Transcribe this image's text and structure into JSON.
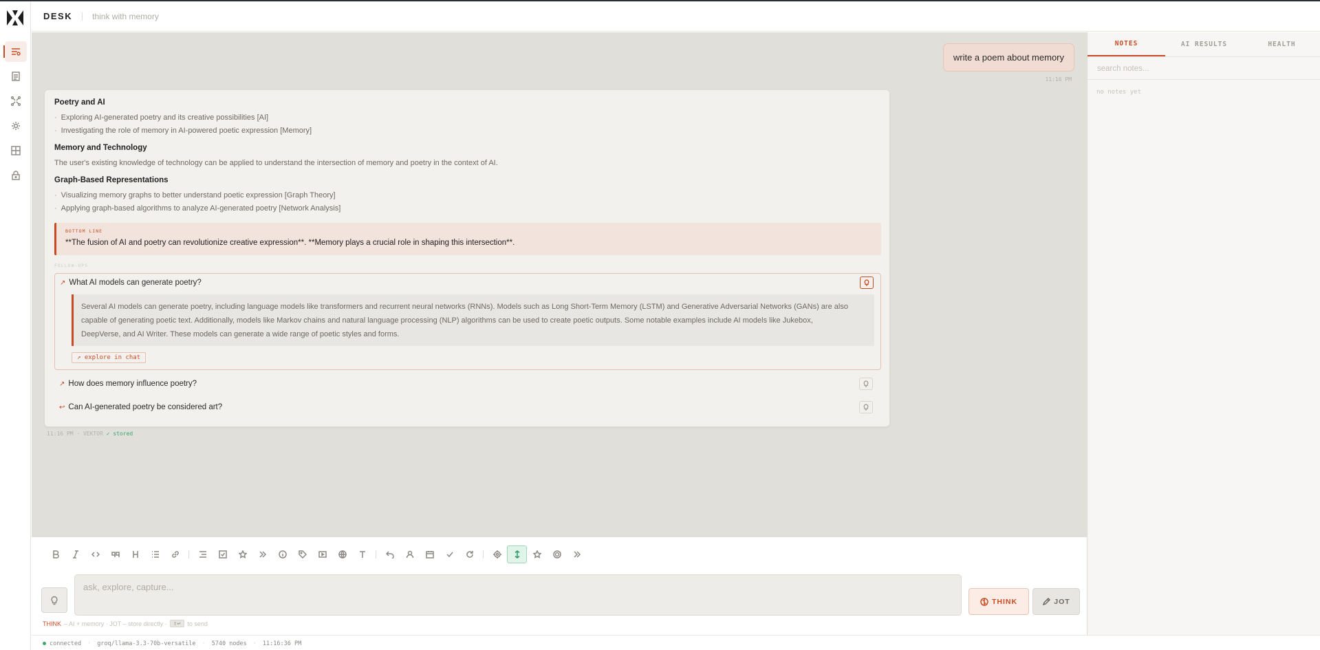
{
  "app": {
    "brand": "DESK",
    "tagline": "think with memory",
    "accent": "#c94a22"
  },
  "chat": {
    "user_message": "write a poem about memory",
    "user_timestamp": "11:16 PM",
    "response": {
      "sections": [
        {
          "heading": "Poetry and AI",
          "items": [
            "Exploring AI-generated poetry and its creative possibilities [AI]",
            "Investigating the role of memory in AI-powered poetic expression [Memory]"
          ]
        },
        {
          "heading": "Memory and Technology",
          "paragraph": "The user's existing knowledge of technology can be applied to understand the intersection of memory and poetry in the context of AI."
        },
        {
          "heading": "Graph-Based Representations",
          "items": [
            "Visualizing memory graphs to better understand poetic expression [Graph Theory]",
            "Applying graph-based algorithms to analyze AI-generated poetry [Network Analysis]"
          ]
        }
      ],
      "bottom_line_label": "BOTTOM LINE",
      "bottom_line": "**The fusion of AI and poetry can revolutionize creative expression**. **Memory plays a crucial role in shaping this intersection**.",
      "followups_label": "FOLLOW-UPS",
      "followups": [
        {
          "arrow": "↗",
          "question": "What AI models can generate poetry?",
          "answer": "Several AI models can generate poetry, including language models like transformers and recurrent neural networks (RNNs). Models such as Long Short-Term Memory (LSTM) and Generative Adversarial Networks (GANs) are also capable of generating poetic text. Additionally, models like Markov chains and natural language processing (NLP) algorithms can be used to create poetic outputs. Some notable examples include AI models like Jukebox, DeepVerse, and AI Writer. These models can generate a wide range of poetic styles and forms.",
          "explore_label": "↗ explore in chat"
        },
        {
          "arrow": "↗",
          "question": "How does memory influence poetry?"
        },
        {
          "arrow": "↩",
          "question": "Can AI-generated poetry be considered art?"
        }
      ],
      "meta_time": "11:16 PM · VEKTOR",
      "meta_stored": "✓ stored"
    }
  },
  "composer": {
    "placeholder": "ask, explore, capture...",
    "think_label": "THINK",
    "jot_label": "JOT",
    "hint_think": "THINK",
    "hint_rest": "– AI + memory  ·  JOT – store directly  ·",
    "hint_kbd": "⇧↵",
    "hint_send": "to send",
    "toolbar_icons": [
      "bold-icon",
      "italic-icon",
      "code-icon",
      "quote-icon",
      "heading-icon",
      "list-icon",
      "link-icon",
      "indent-icon",
      "checkbox-icon",
      "star-icon",
      "chevrons-icon",
      "info-icon",
      "tag-icon",
      "media-icon",
      "globe-icon",
      "text-icon",
      "undo-icon",
      "person-icon",
      "calendar-icon",
      "check-icon",
      "refresh-icon",
      "target-icon",
      "expand-vertical-icon",
      "sparkle-icon",
      "focus-icon",
      "more-icon"
    ]
  },
  "status": {
    "connection": "connected",
    "model": "groq/llama-3.3-70b-versatile",
    "nodes": "5740 nodes",
    "time": "11:16:36 PM"
  },
  "panel": {
    "tabs": [
      "NOTES",
      "AI RESULTS",
      "HEALTH"
    ],
    "search_placeholder": "search notes...",
    "empty": "no notes yet"
  }
}
